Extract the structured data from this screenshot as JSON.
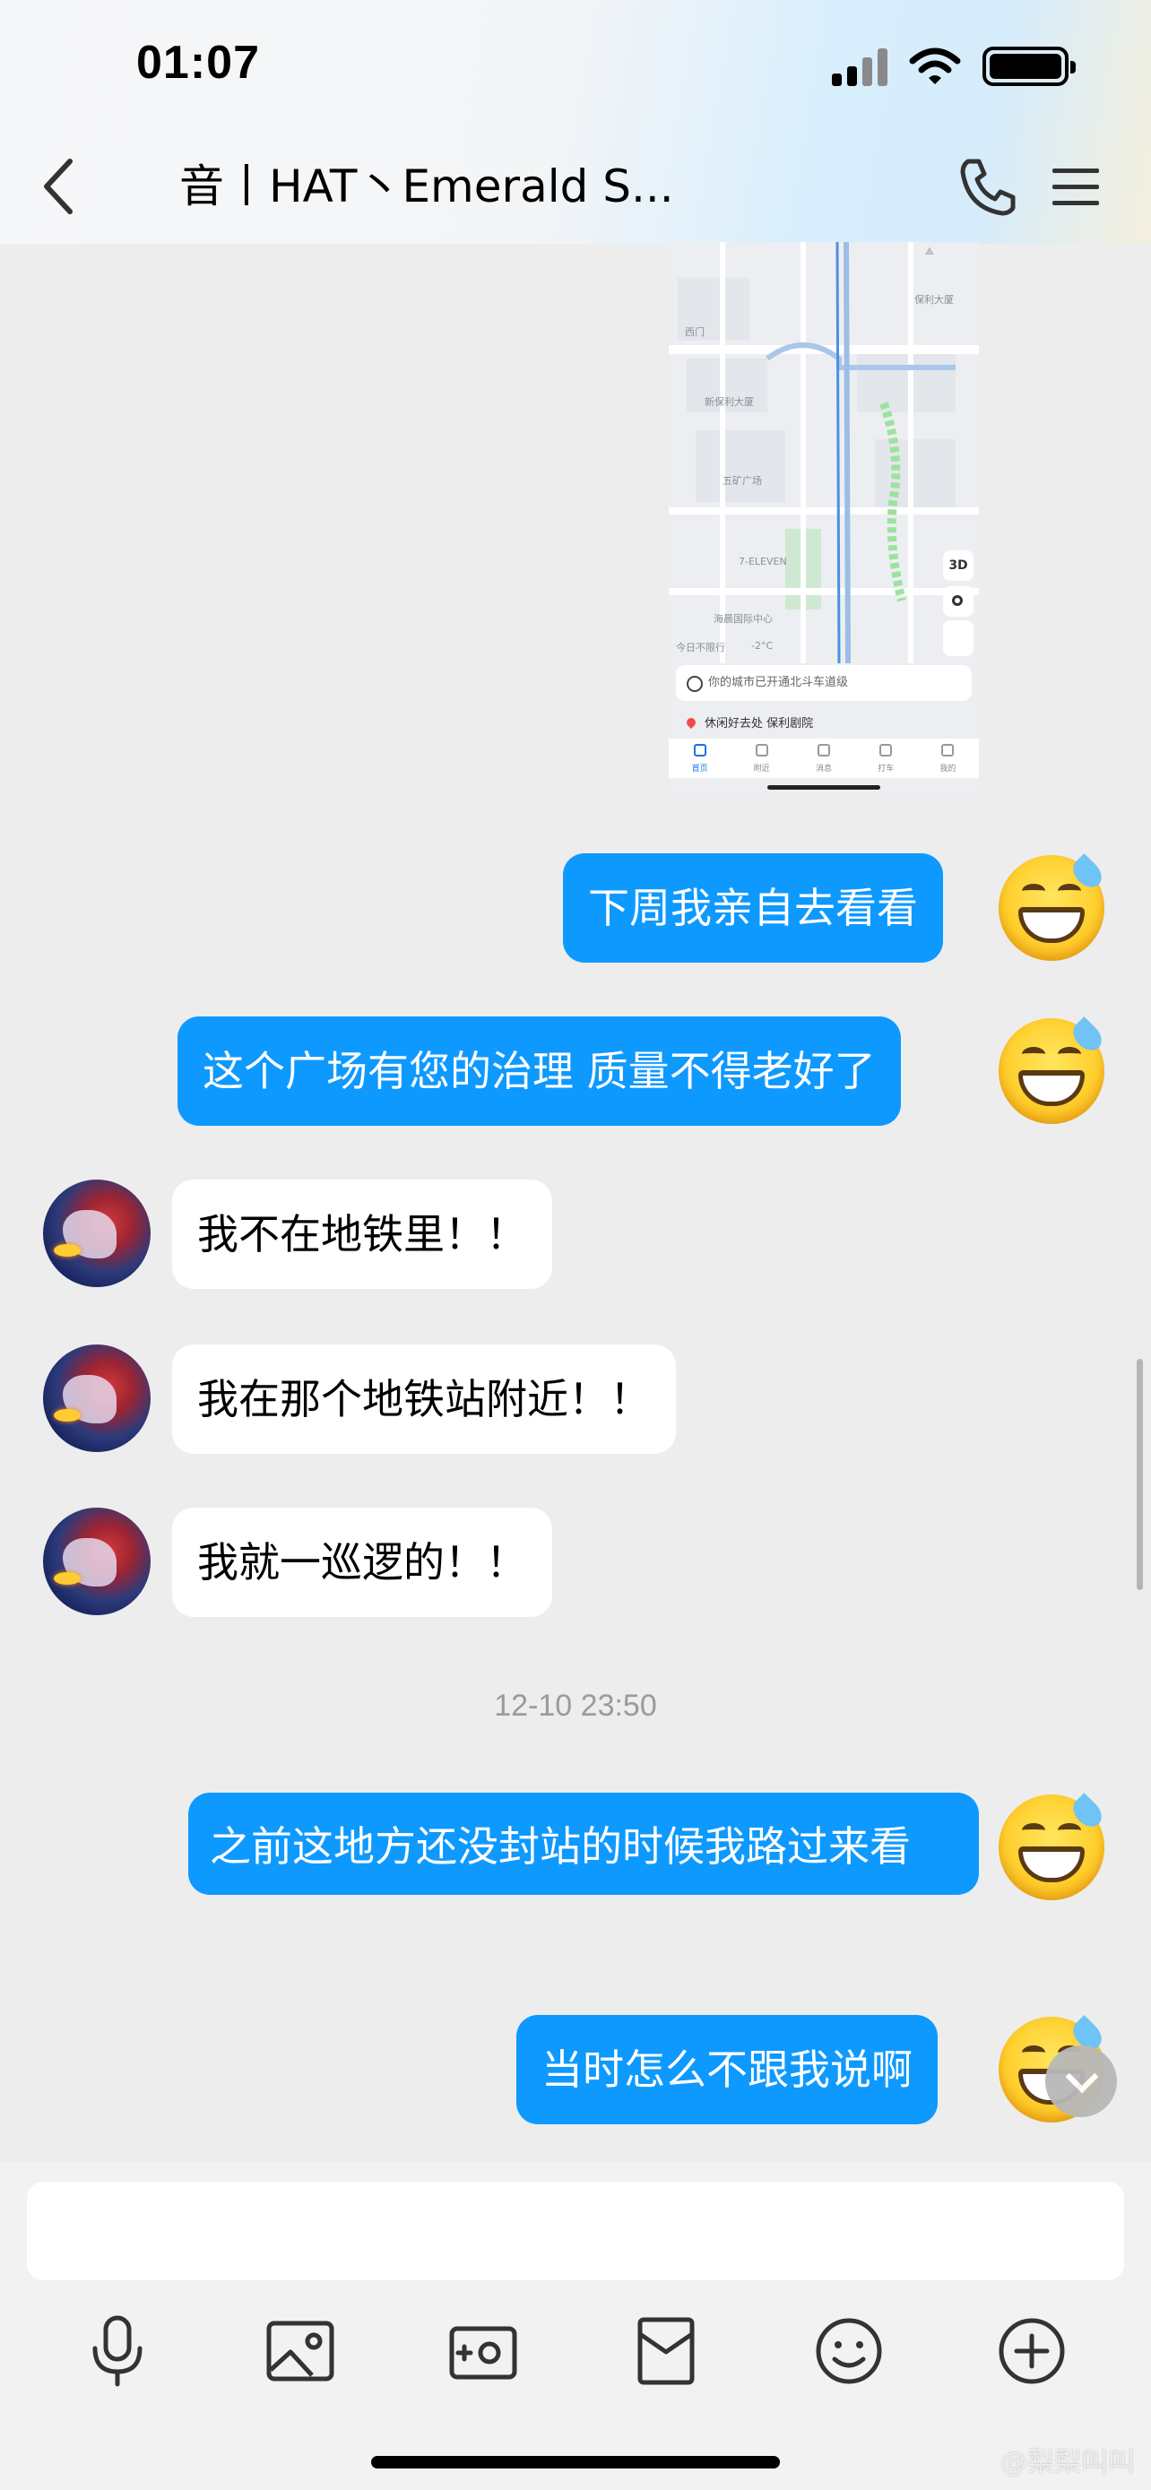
{
  "status_bar": {
    "time": "01:07"
  },
  "header": {
    "title": "音丨HAT丶Emerald S..."
  },
  "map_screenshot": {
    "search_placeholder": "你的城市已开通北斗车道级",
    "poi_text": "休闲好去处 保利剧院",
    "badge_3d": "3D",
    "labels": [
      "保利大厦",
      "新保利大厦",
      "五矿广场",
      "西门",
      "7-ELEVEN",
      "海晨国际中心",
      "今日不限行",
      "-2°C"
    ],
    "tabs": [
      "首页",
      "附近",
      "消息",
      "打车",
      "我的"
    ]
  },
  "messages": [
    {
      "side": "out",
      "text": "下周我亲自去看看"
    },
    {
      "side": "out",
      "text": "这个广场有您的治理 质量不得老好了"
    },
    {
      "side": "in",
      "text": "我不在地铁里！！"
    },
    {
      "side": "in",
      "text": "我在那个地铁站附近！！"
    },
    {
      "side": "in",
      "text": "我就一巡逻的！！"
    },
    {
      "side": "out",
      "text": "之前这地方还没封站的时候我路过来看"
    },
    {
      "side": "out",
      "text": "当时怎么不跟我说啊"
    }
  ],
  "timestamp": "12-10 23:50",
  "input": {
    "value": ""
  },
  "watermark": "@梨梨叫叫",
  "colors": {
    "bubble_out": "#0e99ff",
    "bubble_in": "#ffffff",
    "background": "#ededed"
  },
  "icons": [
    "back-icon",
    "phone-icon",
    "menu-icon",
    "microphone-icon",
    "image-icon",
    "camera-icon",
    "red-packet-icon",
    "emoji-icon",
    "plus-icon"
  ]
}
